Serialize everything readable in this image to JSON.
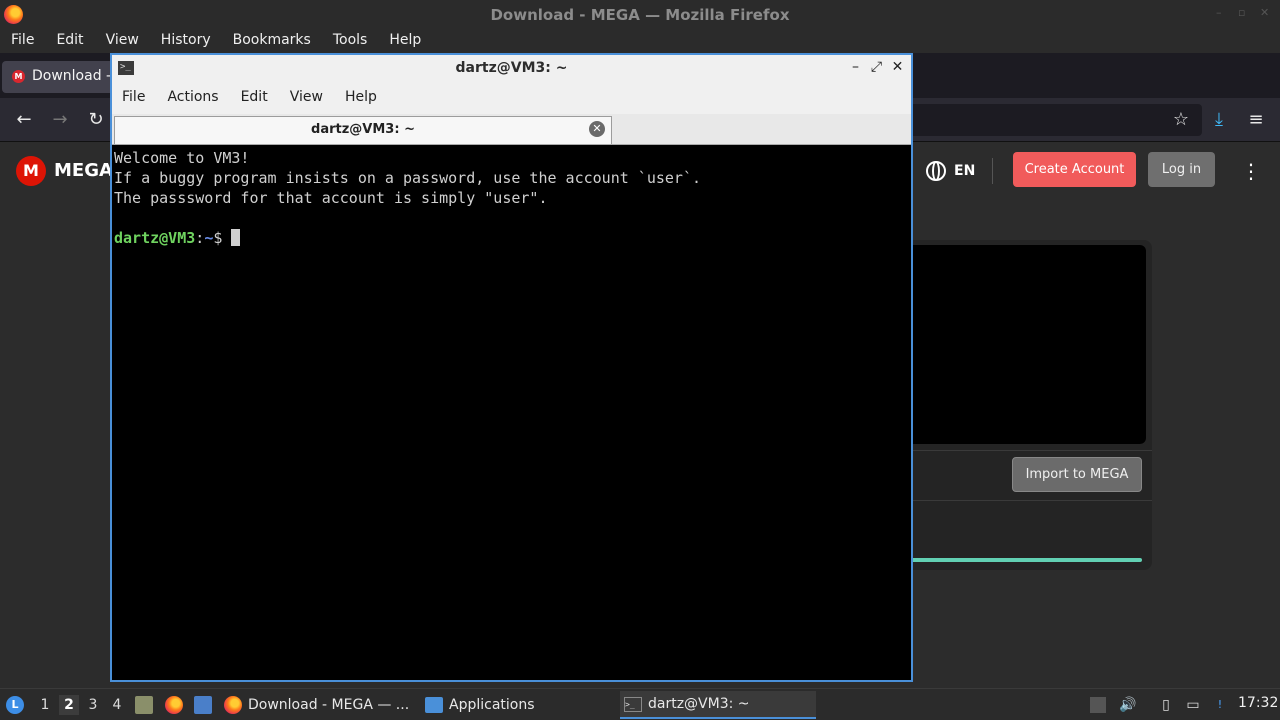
{
  "firefox": {
    "window_title": "Download - MEGA — Mozilla Firefox",
    "menu": [
      "File",
      "Edit",
      "View",
      "History",
      "Bookmarks",
      "Tools",
      "Help"
    ],
    "tab_label": "Download -",
    "tab_favicon": "M"
  },
  "mega": {
    "logo_letter": "M",
    "wordmark": "MEGA",
    "language": "EN",
    "create_account": "Create Account",
    "login": "Log in",
    "import_button": "Import to MEGA"
  },
  "terminal": {
    "window_title": "dartz@VM3: ~",
    "menu": [
      "File",
      "Actions",
      "Edit",
      "View",
      "Help"
    ],
    "tab_label": "dartz@VM3: ~",
    "lines": [
      "Welcome to VM3!",
      "If a buggy program insists on a password, use the account `user`.",
      "The passsword for that account is simply \"user\"."
    ],
    "prompt_user": "dartz@VM3",
    "prompt_sep": ":",
    "prompt_path": "~",
    "prompt_symbol": "$ "
  },
  "taskbar": {
    "workspaces": [
      "1",
      "2",
      "3",
      "4"
    ],
    "active_workspace": "2",
    "tasks": {
      "firefox": "Download - MEGA — ...",
      "applications": "Applications",
      "terminal": "dartz@VM3: ~"
    },
    "clock": "17:32"
  },
  "colors": {
    "accent": "#4a90d9",
    "mega_red": "#dd1405",
    "create_account_bg": "#f15b5b",
    "prompt_user": "#6fd35f",
    "prompt_path": "#6a8de8",
    "progress": "#62d0b3"
  }
}
